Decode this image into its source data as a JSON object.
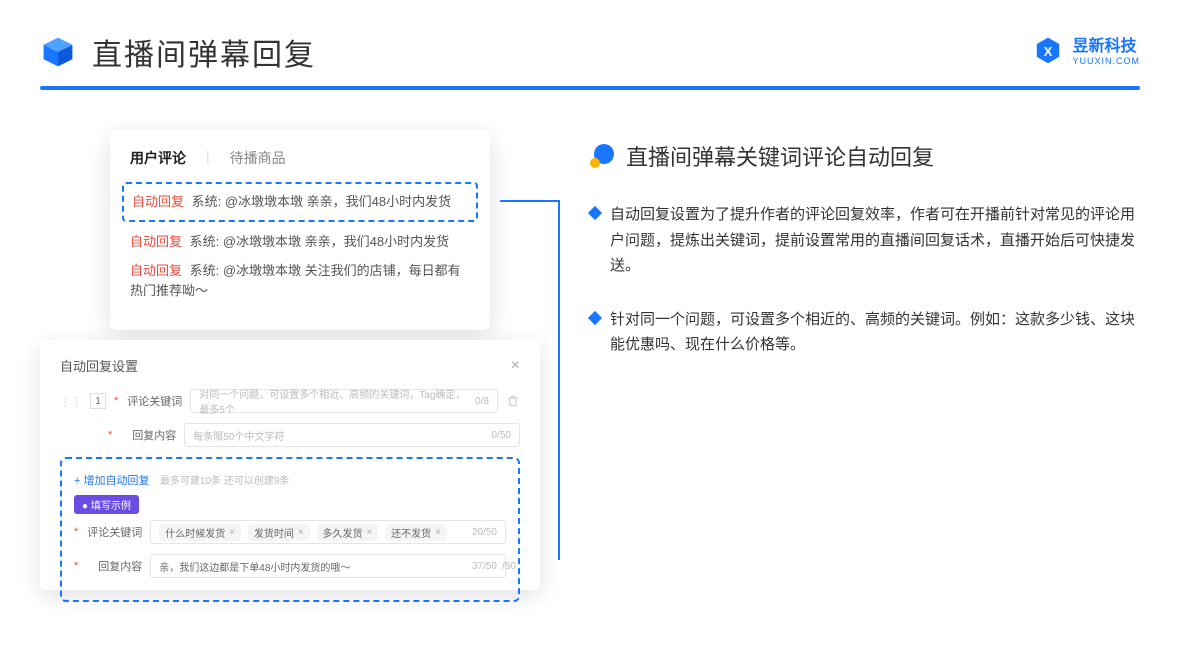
{
  "header": {
    "title": "直播间弹幕回复",
    "brand_name": "昱新科技",
    "brand_sub": "YUUXIN.COM"
  },
  "preview": {
    "tabs": {
      "active": "用户评论",
      "inactive": "待播商品"
    },
    "comments": [
      {
        "tag": "自动回复",
        "text": "系统: @冰墩墩本墩 亲亲，我们48小时内发货"
      },
      {
        "tag": "自动回复",
        "text": "系统: @冰墩墩本墩 亲亲，我们48小时内发货"
      },
      {
        "tag": "自动回复",
        "text": "系统: @冰墩墩本墩 关注我们的店铺，每日都有热门推荐呦～"
      }
    ]
  },
  "modal": {
    "title": "自动回复设置",
    "number": "1",
    "row_keyword": {
      "label": "评论关键词",
      "placeholder": "对同一个问题，可设置多个相近、高频的关键词，Tag确定，最多5个",
      "counter": "0/8"
    },
    "row_reply": {
      "label": "回复内容",
      "placeholder": "每条限50个中文字符",
      "counter": "0/50"
    },
    "add_link": "+ 增加自动回复",
    "add_hint": "最多可建10条 还可以创建9条",
    "example_pill": "● 填写示例",
    "ex_keyword_label": "评论关键词",
    "ex_chips": [
      "什么时候发货",
      "发货时间",
      "多久发货",
      "还不发货"
    ],
    "ex_chip_counter": "20/50",
    "ex_reply_label": "回复内容",
    "ex_reply_value": "亲，我们这边都是下单48小时内发货的哦～",
    "ex_reply_counter": "37/50",
    "outer_counter": "/50"
  },
  "right": {
    "section_title": "直播间弹幕关键词评论自动回复",
    "bullets": [
      "自动回复设置为了提升作者的评论回复效率，作者可在开播前针对常见的评论用户问题，提炼出关键词，提前设置常用的直播间回复话术，直播开始后可快捷发送。",
      "针对同一个问题，可设置多个相近的、高频的关键词。例如：这款多少钱、这块能优惠吗、现在什么价格等。"
    ]
  }
}
